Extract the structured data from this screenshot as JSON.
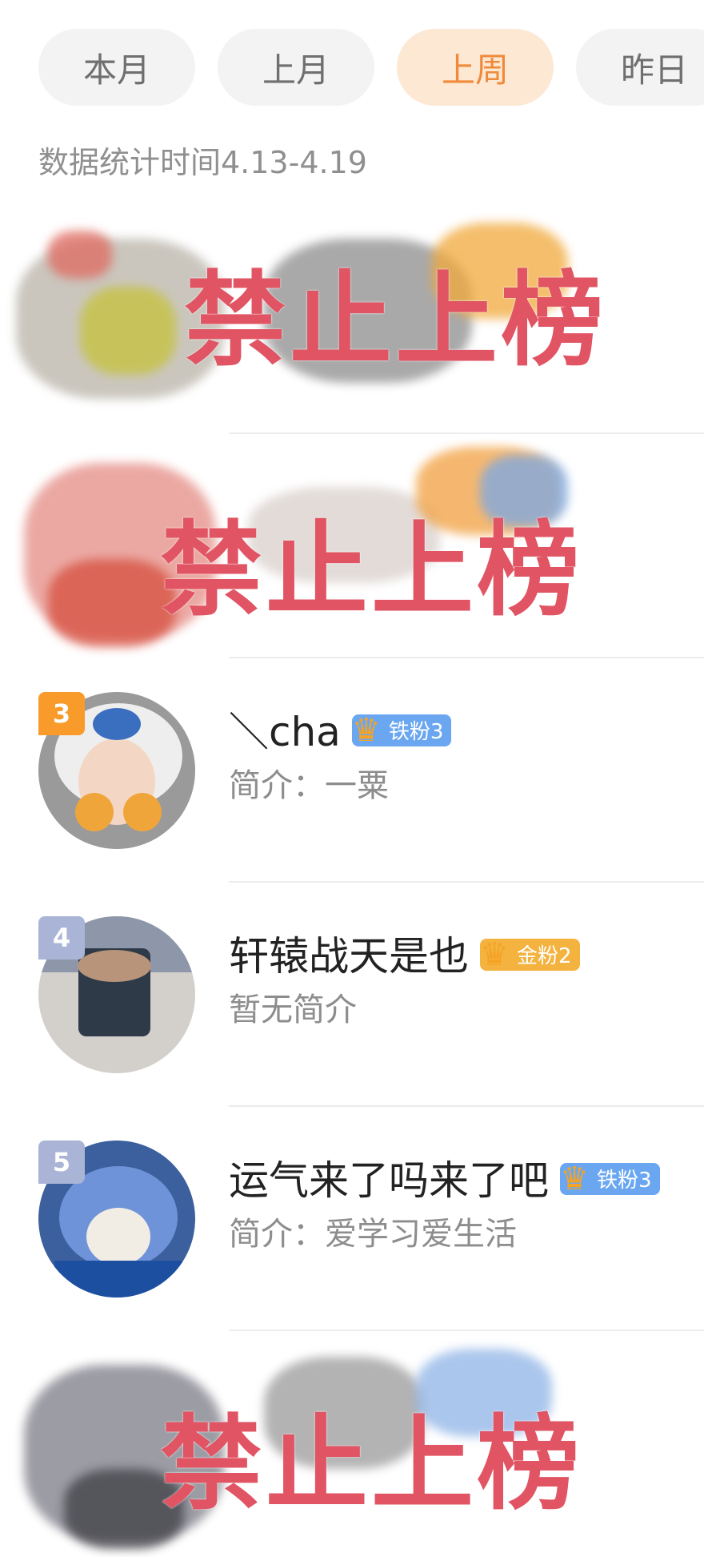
{
  "tabs": [
    {
      "label": "本月",
      "active": false
    },
    {
      "label": "上月",
      "active": false
    },
    {
      "label": "上周",
      "active": true
    },
    {
      "label": "昨日",
      "active": false
    }
  ],
  "stat_period": "数据统计时间4.13-4.19",
  "banned_label": "禁止上榜",
  "ranks": [
    {
      "rank": "3",
      "name": "＼cha",
      "badge": "铁粉3",
      "badge_type": "iron",
      "intro": "简介：一粟",
      "rank_color": "#f89b2b"
    },
    {
      "rank": "4",
      "name": "轩辕战天是也",
      "badge": "金粉2",
      "badge_type": "gold",
      "intro": "暂无简介",
      "rank_color": "#a9b4d6"
    },
    {
      "rank": "5",
      "name": "运气来了吗来了吧",
      "badge": "铁粉3",
      "badge_type": "iron",
      "intro": "简介：爱学习爱生活",
      "rank_color": "#a9b4d6"
    }
  ],
  "colors": {
    "accent": "#f08a3a",
    "stamp": "#e15463",
    "iron_badge": "#6aa7f0",
    "gold_badge": "#f4b23e"
  },
  "icons": [
    "crown-icon"
  ]
}
